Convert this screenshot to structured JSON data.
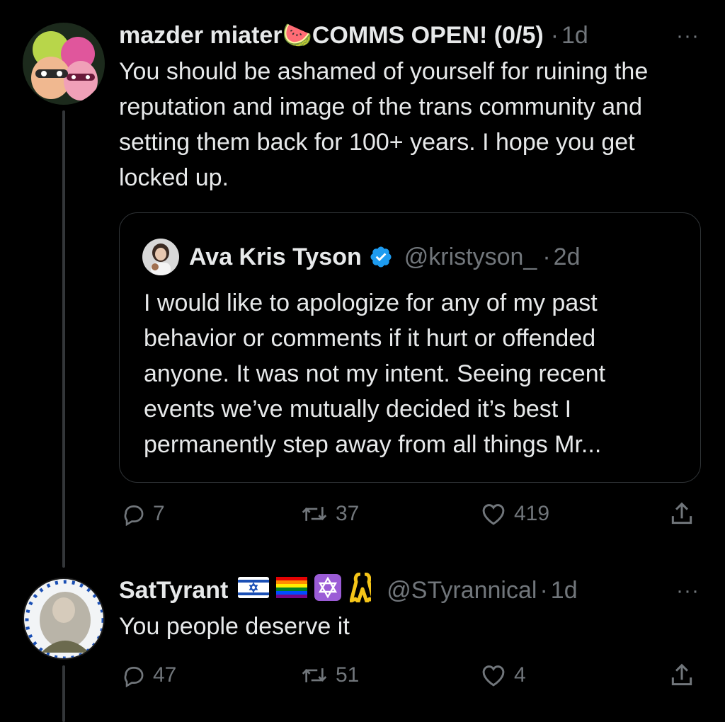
{
  "tweet1": {
    "name": "mazder miater🍉COMMS OPEN! (0/5)",
    "dot": "·",
    "time": "1d",
    "more": "···",
    "text": "You should be ashamed of yourself for ruining the reputation and image of the trans community and setting them back for 100+ years. I hope you get locked up.",
    "quote": {
      "name": "Ava Kris Tyson",
      "handle": "@kristyson_",
      "dot": "·",
      "time": "2d",
      "text": "I would like to apologize for any of my past behavior or comments if it hurt or offended anyone. It was not my intent. Seeing recent events we’ve mutually decided it’s best I permanently step away from all things Mr..."
    },
    "replies": "7",
    "retweets": "37",
    "likes": "419"
  },
  "tweet2": {
    "name": "SatTyrant",
    "handle": "@STyrannical",
    "dot": "·",
    "time": "1d",
    "more": "···",
    "text": "You people deserve it",
    "replies": "47",
    "retweets": "51",
    "likes": "4"
  },
  "icons": {
    "reply": "reply-icon",
    "retweet": "retweet-icon",
    "like": "heart-icon",
    "share": "share-icon",
    "verified": "verified-badge-icon"
  },
  "colors": {
    "background": "#000000",
    "text": "#e7e9ea",
    "muted": "#71767b",
    "verified": "#1d9bf0",
    "border": "#2f3336"
  }
}
